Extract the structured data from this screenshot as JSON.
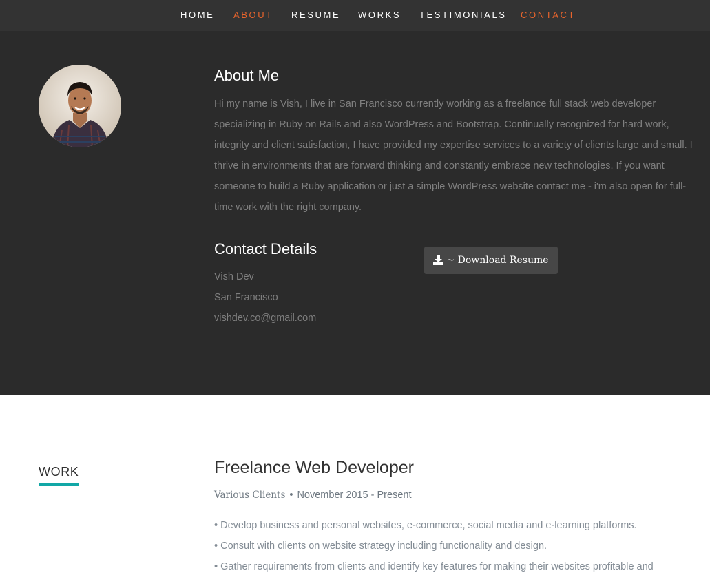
{
  "nav": {
    "items": [
      {
        "label": "HOME",
        "active": false
      },
      {
        "label": "ABOUT",
        "active": true
      },
      {
        "label": "RESUME",
        "active": false
      },
      {
        "label": "WORKS",
        "active": false
      },
      {
        "label": "TESTIMONIALS",
        "active": false
      },
      {
        "label": "CONTACT",
        "active": true
      }
    ]
  },
  "about": {
    "heading": "About Me",
    "paragraph": "Hi my name is Vish, I live in San Francisco currently working as a freelance full stack web developer specializing in Ruby on Rails and also WordPress and Bootstrap. Continually recognized for hard work, integrity and client satisfaction, I have provided my expertise services to a variety of clients large and small. I thrive in environments that are forward thinking and constantly embrace new technologies. If you want someone to build a Ruby application or just a simple WordPress website contact me - i'm also open for full-time work with the right company."
  },
  "contact": {
    "heading": "Contact Details",
    "name": "Vish Dev",
    "city": "San Francisco",
    "email": "vishdev.co@gmail.com"
  },
  "download_button": {
    "label": "~ Download Resume",
    "icon": "download-icon"
  },
  "work": {
    "section_label": "WORK",
    "job_title": "Freelance Web Developer",
    "company": "Various Clients",
    "separator": "•",
    "dates": "November 2015 - Present",
    "bullets": [
      "• Develop business and personal websites, e-commerce, social media and e-learning platforms.",
      "• Consult with clients on website strategy including functionality and design.",
      "• Gather requirements from clients and identify key features for making their websites profitable and"
    ]
  },
  "colors": {
    "accent": "#e8642c",
    "teal": "#11a7a6",
    "dark_bg": "#2b2b2b",
    "nav_bg": "#333333"
  }
}
